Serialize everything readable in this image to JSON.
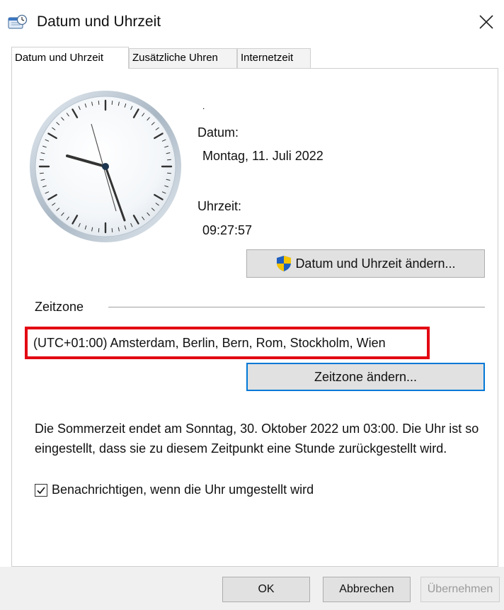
{
  "window": {
    "title": "Datum und Uhrzeit",
    "close_icon": "close-icon"
  },
  "tabs": [
    {
      "label": "Datum und Uhrzeit",
      "active": true
    },
    {
      "label": "Zusätzliche Uhren",
      "active": false
    },
    {
      "label": "Internetzeit",
      "active": false
    }
  ],
  "datetime": {
    "dot": ".",
    "date_label": "Datum:",
    "date_value": "Montag, 11. Juli 2022",
    "time_label": "Uhrzeit:",
    "time_value": "09:27:57",
    "change_button": "Datum und Uhrzeit ändern..."
  },
  "timezone": {
    "section_label": "Zeitzone",
    "value": "(UTC+01:00) Amsterdam, Berlin, Bern, Rom, Stockholm, Wien",
    "change_button": "Zeitzone ändern...",
    "highlight_color": "#e30613"
  },
  "dst": {
    "text": "Die Sommerzeit endet am Sonntag, 30. Oktober 2022 um 03:00. Die Uhr ist so eingestellt, dass sie zu diesem Zeitpunkt eine Stunde zurückgestellt wird.",
    "notify_label": "Benachrichtigen, wenn die Uhr umgestellt wird",
    "notify_checked": true
  },
  "buttons": {
    "ok": "OK",
    "cancel": "Abbrechen",
    "apply": "Übernehmen",
    "apply_enabled": false
  },
  "colors": {
    "accent": "#0078d7",
    "uac_shield_blue": "#1f5fbf",
    "uac_shield_yellow": "#f5c400"
  }
}
